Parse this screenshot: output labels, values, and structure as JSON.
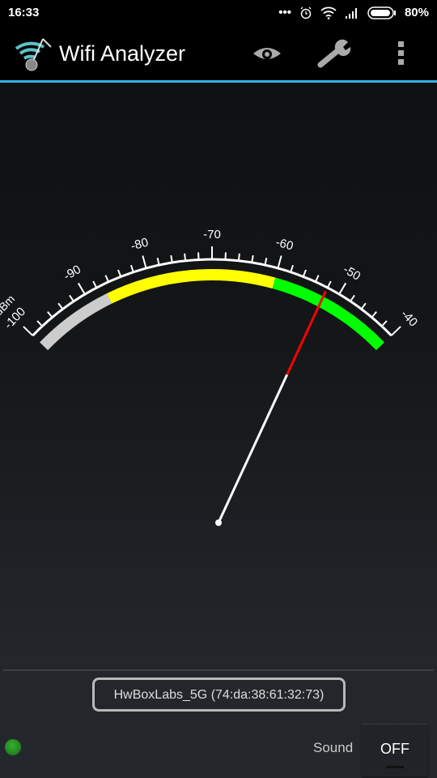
{
  "status_bar": {
    "time": "16:33",
    "battery": "80%",
    "icons": [
      "more-dots-icon",
      "alarm-icon",
      "wifi-icon",
      "signal-icon",
      "battery-icon"
    ]
  },
  "app_bar": {
    "title": "Wifi Analyzer",
    "actions": [
      "eye-icon",
      "wrench-icon",
      "overflow-menu-icon"
    ],
    "accent": "#33b5e5"
  },
  "gauge": {
    "unit": "dBm",
    "min": -100,
    "max": -40,
    "major_step": 10,
    "minor_step": 2,
    "labels": [
      "-100",
      "-90",
      "-80",
      "-70",
      "-60",
      "-50",
      "-40"
    ],
    "bands": [
      {
        "from": -100,
        "to": -87,
        "color": "#cccccc"
      },
      {
        "from": -87,
        "to": -60,
        "color": "#ffff00"
      },
      {
        "from": -60,
        "to": -40,
        "color": "#00ff00"
      }
    ],
    "needle_value": -52,
    "needle_color": "#ff0000"
  },
  "network": {
    "label": "HwBoxLabs_5G (74:da:38:61:32:73)"
  },
  "bottom": {
    "indicator_color": "#2ea22a",
    "sound_label": "Sound",
    "sound_toggle": "OFF"
  }
}
